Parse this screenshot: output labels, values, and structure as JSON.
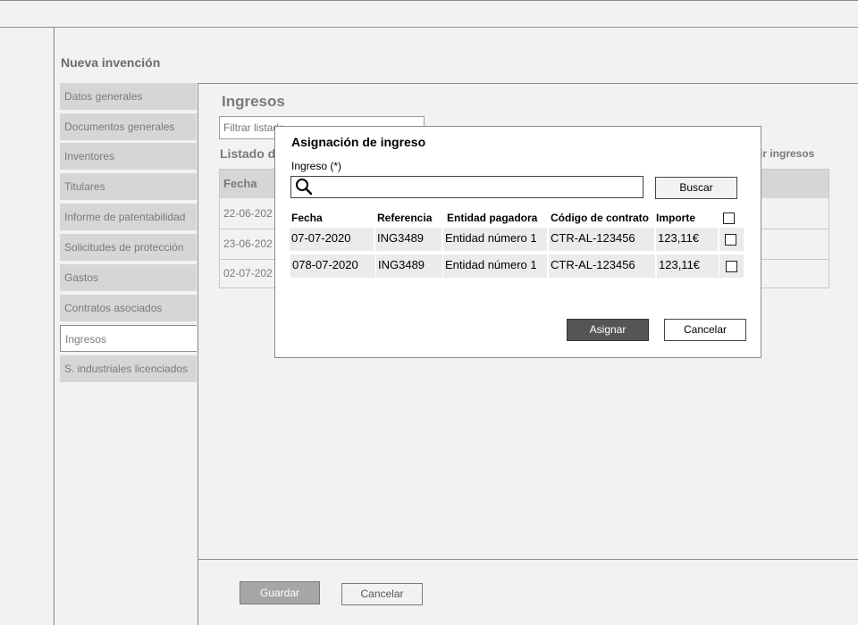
{
  "page": {
    "title": "Nueva invención"
  },
  "sidebar": {
    "items": [
      {
        "label": "Datos generales"
      },
      {
        "label": "Documentos generales"
      },
      {
        "label": "Inventores"
      },
      {
        "label": "Titulares"
      },
      {
        "label": "Informe de patentabilidad"
      },
      {
        "label": "Solicitudes de protección"
      },
      {
        "label": "Gastos"
      },
      {
        "label": "Contratos asociados"
      },
      {
        "label": "Ingresos",
        "active": true
      },
      {
        "label": "S. industriales licenciados"
      }
    ]
  },
  "content": {
    "title": "Ingresos",
    "filter_placeholder": "Filtrar listado",
    "list_heading": "Listado d",
    "add_link": "adir ingresos",
    "table": {
      "header": "Fecha",
      "rows": [
        "22-06-202",
        "23-06-202",
        "02-07-202"
      ]
    }
  },
  "footer": {
    "save_label": "Guardar",
    "cancel_label": "Cancelar"
  },
  "modal": {
    "title": "Asignación de ingreso",
    "field_label": "Ingreso (*)",
    "field_value": "",
    "search_button": "Buscar",
    "columns": [
      "Fecha",
      "Referencia",
      "Entidad pagadora",
      "Código de contrato",
      "Importe"
    ],
    "rows": [
      [
        "07-07-2020",
        "ING3489",
        "Entidad número 1",
        "CTR-AL-123456",
        "123,11€"
      ],
      [
        "078-07-2020",
        "ING3489",
        "Entidad número 1",
        "CTR-AL-123456",
        "123,11€"
      ]
    ],
    "assign_button": "Asignar",
    "cancel_button": "Cancelar"
  },
  "icons": {
    "search": "search-icon",
    "checkbox": "checkbox"
  }
}
